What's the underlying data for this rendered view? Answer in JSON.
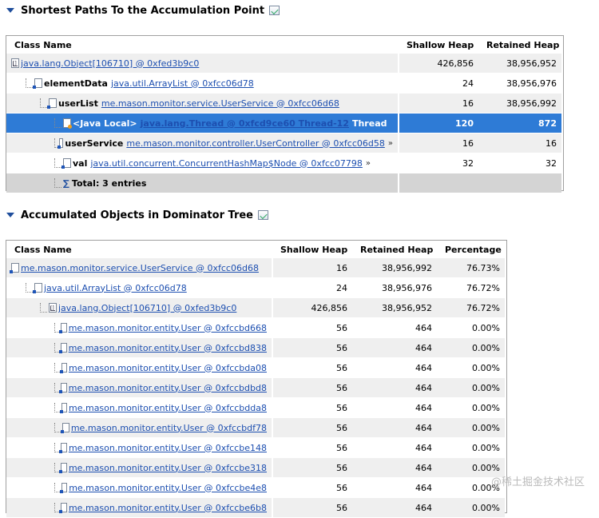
{
  "section1": {
    "title": "Shortest Paths To the Accumulation Point",
    "columns": [
      "Class Name",
      "Shallow Heap",
      "Retained Heap"
    ],
    "rows": [
      {
        "field": "",
        "link": "java.lang.Object[106710] @ 0xfed3b9c0",
        "suffix": "",
        "shallow": "426,856",
        "retained": "38,956,952",
        "icon": "array-icon"
      },
      {
        "field": "elementData",
        "link": "java.util.ArrayList @ 0xfcc06d78",
        "suffix": "",
        "shallow": "24",
        "retained": "38,956,976",
        "icon": "object-icon"
      },
      {
        "field": "userList",
        "link": "me.mason.monitor.service.UserService @ 0xfcc06d68",
        "suffix": "",
        "shallow": "16",
        "retained": "38,956,992",
        "icon": "object-icon"
      },
      {
        "field": "<Java Local>",
        "link": "java.lang.Thread @ 0xfcd9ce60 Thread-12",
        "suffix": "Thread",
        "shallow": "120",
        "retained": "872",
        "icon": "local-icon"
      },
      {
        "field": "userService",
        "link": "me.mason.monitor.controller.UserController @ 0xfcc06d58",
        "suffix": "»",
        "shallow": "16",
        "retained": "16",
        "icon": "object-icon"
      },
      {
        "field": "val",
        "link": "java.util.concurrent.ConcurrentHashMap$Node @ 0xfcc07798",
        "suffix": "»",
        "shallow": "32",
        "retained": "32",
        "icon": "object-icon"
      }
    ],
    "total": "Total: 3 entries"
  },
  "section2": {
    "title": "Accumulated Objects in Dominator Tree",
    "columns": [
      "Class Name",
      "Shallow Heap",
      "Retained Heap",
      "Percentage"
    ],
    "rows": [
      {
        "link": "me.mason.monitor.service.UserService @ 0xfcc06d68",
        "shallow": "16",
        "retained": "38,956,992",
        "pct": "76.73%",
        "icon": "object-icon"
      },
      {
        "link": "java.util.ArrayList @ 0xfcc06d78",
        "shallow": "24",
        "retained": "38,956,976",
        "pct": "76.72%",
        "icon": "object-icon"
      },
      {
        "link": "java.lang.Object[106710] @ 0xfed3b9c0",
        "shallow": "426,856",
        "retained": "38,956,952",
        "pct": "76.72%",
        "icon": "array-icon"
      },
      {
        "link": "me.mason.monitor.entity.User @ 0xfccbd668",
        "shallow": "56",
        "retained": "464",
        "pct": "0.00%",
        "icon": "object-icon"
      },
      {
        "link": "me.mason.monitor.entity.User @ 0xfccbd838",
        "shallow": "56",
        "retained": "464",
        "pct": "0.00%",
        "icon": "object-icon"
      },
      {
        "link": "me.mason.monitor.entity.User @ 0xfccbda08",
        "shallow": "56",
        "retained": "464",
        "pct": "0.00%",
        "icon": "object-icon"
      },
      {
        "link": "me.mason.monitor.entity.User @ 0xfccbdbd8",
        "shallow": "56",
        "retained": "464",
        "pct": "0.00%",
        "icon": "object-icon"
      },
      {
        "link": "me.mason.monitor.entity.User @ 0xfccbdda8",
        "shallow": "56",
        "retained": "464",
        "pct": "0.00%",
        "icon": "object-icon"
      },
      {
        "link": "me.mason.monitor.entity.User @ 0xfccbdf78",
        "shallow": "56",
        "retained": "464",
        "pct": "0.00%",
        "icon": "object-icon"
      },
      {
        "link": "me.mason.monitor.entity.User @ 0xfccbe148",
        "shallow": "56",
        "retained": "464",
        "pct": "0.00%",
        "icon": "object-icon"
      },
      {
        "link": "me.mason.monitor.entity.User @ 0xfccbe318",
        "shallow": "56",
        "retained": "464",
        "pct": "0.00%",
        "icon": "object-icon"
      },
      {
        "link": "me.mason.monitor.entity.User @ 0xfccbe4e8",
        "shallow": "56",
        "retained": "464",
        "pct": "0.00%",
        "icon": "object-icon"
      },
      {
        "link": "me.mason.monitor.entity.User @ 0xfccbe6b8",
        "shallow": "56",
        "retained": "464",
        "pct": "0.00%",
        "icon": "object-icon"
      }
    ]
  },
  "watermark": "@稀土掘金技术社区"
}
